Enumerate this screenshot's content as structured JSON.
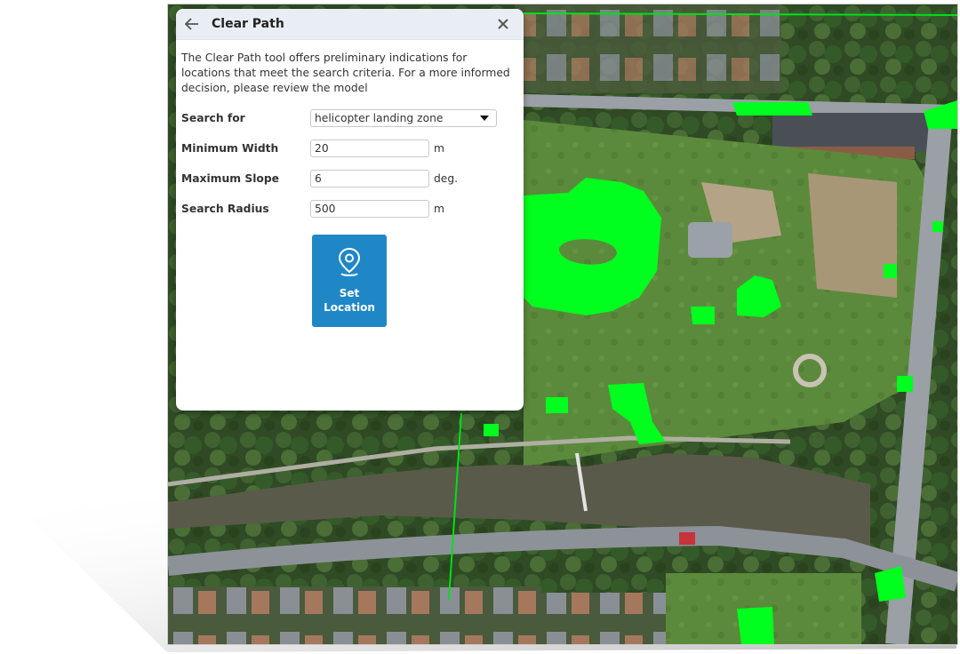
{
  "colors": {
    "panel_header_bg": "#e9eef5",
    "button_bg": "#1f87c6",
    "clear_area_highlight": "#00ff1e"
  },
  "map": {
    "description_icon": "aerial-map-view"
  },
  "panel": {
    "title": "Clear Path",
    "back_icon": "arrow-left-icon",
    "close_icon": "close-icon",
    "description": "The Clear Path tool offers preliminary indications for locations that meet the search criteria. For a more informed decision, please review the model",
    "fields": {
      "search_for": {
        "label": "Search for",
        "value": "helicopter landing zone"
      },
      "min_width": {
        "label": "Minimum Width",
        "value": "20",
        "unit": "m"
      },
      "max_slope": {
        "label": "Maximum Slope",
        "value": "6",
        "unit": "deg."
      },
      "search_radius": {
        "label": "Search Radius",
        "value": "500",
        "unit": "m"
      }
    },
    "set_location": {
      "label_line1": "Set",
      "label_line2": "Location",
      "icon": "map-pin-icon"
    }
  }
}
